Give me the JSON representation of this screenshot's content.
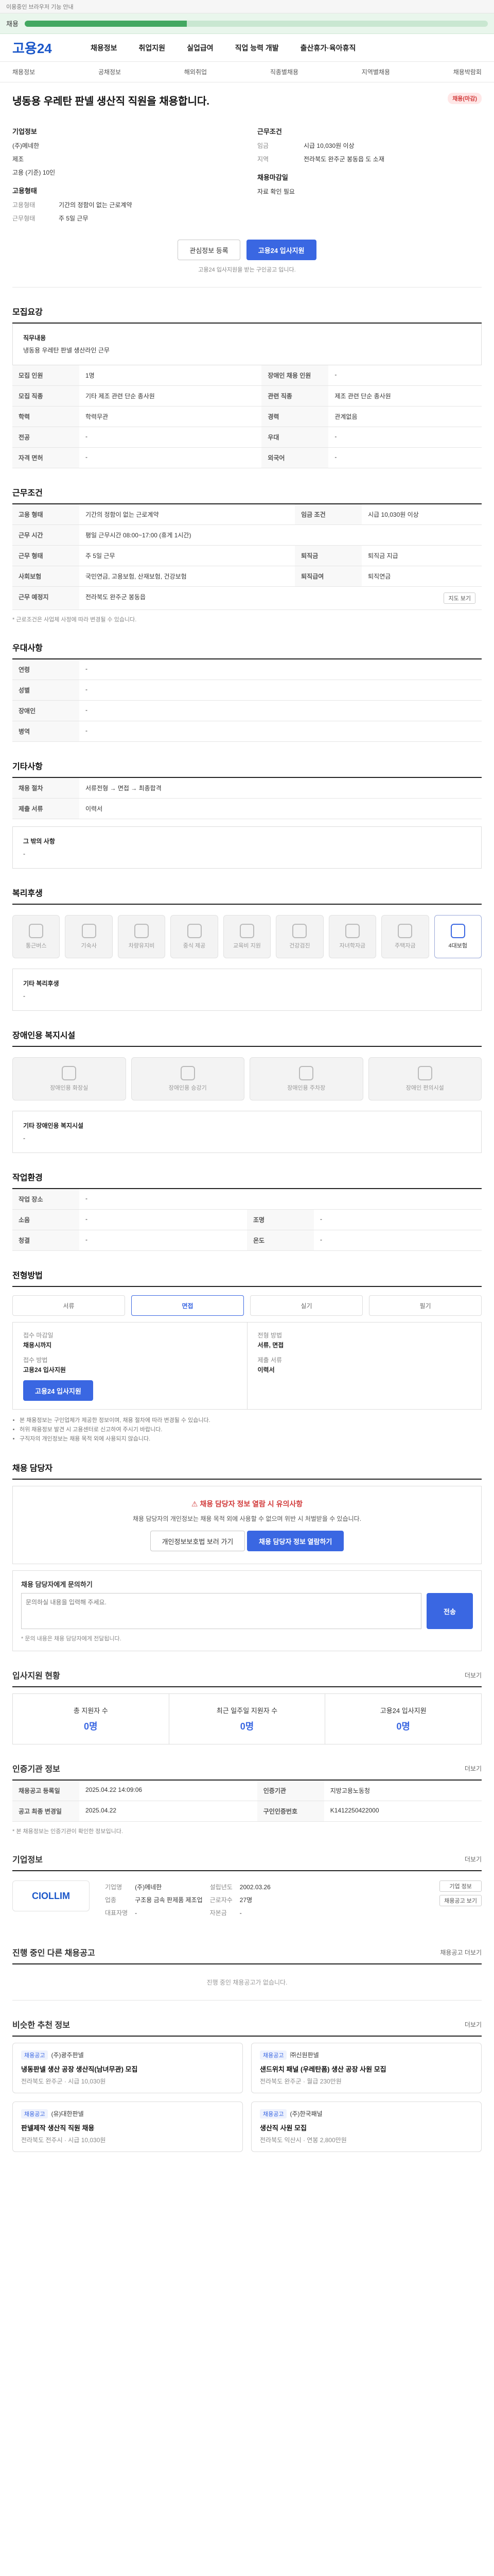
{
  "top": {
    "notice": "이용중인 브라우저 기능 안내",
    "banner_label": "채용"
  },
  "gnb": {
    "logo": "고용24",
    "items": [
      "채용정보",
      "취업지원",
      "실업급여",
      "직업 능력 개발",
      "출산휴가·육아휴직"
    ]
  },
  "subnav": {
    "items": [
      "채용정보",
      "공채정보",
      "해외취업",
      "직종별채용",
      "지역별채용",
      "채용박람회"
    ]
  },
  "job": {
    "title": "냉동용 우레탄 판넬 생산직 직원을 채용합니다.",
    "status_badge": "채용(마감)",
    "company_head": "기업정보",
    "company_name": "(주)메네한",
    "company_meta": [
      "제조",
      "고용 (기준) 10인"
    ],
    "work_head": "근무조건",
    "work_rows": [
      {
        "k": "임금",
        "v": "시급 10,030원 이상"
      },
      {
        "k": "지역",
        "v": "전라북도 완주군 봉동읍 도 소재"
      }
    ],
    "hire_head": "고용형태",
    "hire_rows": [
      {
        "k": "고용형태",
        "v": "기간의 정함이 없는 근로계약"
      },
      {
        "k": "근무형태",
        "v": "주 5일 근무"
      }
    ],
    "deadline_head": "채용마감일",
    "deadline": "자료 확인 필요",
    "save_button": "관심정보 등록",
    "apply_button": "고용24 입사지원",
    "apply_note": "고용24 입사지원을 받는 구인공고 입니다."
  },
  "recruit": {
    "title": "모집요강",
    "duty_title": "직무내용",
    "duty_text": "냉동용 우레탄 판넬 생산라인 근무",
    "rows": [
      {
        "k": "모집 인원",
        "v": "1명",
        "k2": "장애인 채용 인원",
        "v2": "-"
      },
      {
        "k": "모집 직종",
        "v": "기타 제조 관련 단순 종사원",
        "k2": "관련 직종",
        "v2": "제조 관련 단순 종사원"
      },
      {
        "k": "학력",
        "v": "학력무관",
        "k2": "경력",
        "v2": "관계없음"
      },
      {
        "k": "전공",
        "v": "-",
        "k2": "우대",
        "v2": "-"
      },
      {
        "k": "자격 면허",
        "v": "-",
        "k2": "외국어",
        "v2": "-"
      }
    ]
  },
  "conditions": {
    "title": "근무조건",
    "rows": [
      {
        "k": "고용 형태",
        "v": "기간의 정함이 없는 근로계약",
        "k2": "임금 조건",
        "v2": "시급 10,030원 이상"
      },
      {
        "k": "근무 시간",
        "v": "평일 근무시간 08:00~17:00 (휴게 1시간)",
        "k2": "",
        "v2": ""
      },
      {
        "k": "근무 형태",
        "v": "주 5일 근무",
        "k2": "퇴직금",
        "v2": "퇴직금 지급"
      },
      {
        "k": "사회보험",
        "v": "국민연금, 고용보험, 산재보험, 건강보험",
        "k2": "퇴직급여",
        "v2": "퇴직연금"
      },
      {
        "k": "근무 예정지",
        "v": "전라북도 완주군 봉동읍",
        "k2": "",
        "v2": ""
      }
    ],
    "map_button": "지도 보기",
    "foot": "* 근로조건은 사업체 사정에 따라 변경될 수 있습니다."
  },
  "preference": {
    "title": "우대사항",
    "rows": [
      {
        "k": "연령",
        "v": "-"
      },
      {
        "k": "성별",
        "v": "-"
      },
      {
        "k": "장애인",
        "v": "-"
      },
      {
        "k": "병역",
        "v": "-"
      }
    ]
  },
  "other": {
    "title": "기타사항",
    "rows": [
      {
        "k": "채용 절차",
        "v": "서류전형 → 면접 → 최종합격"
      },
      {
        "k": "제출 서류",
        "v": "이력서"
      }
    ],
    "sub_title": "그 밖의 사항",
    "sub_text": "-"
  },
  "welfare": {
    "title": "복리후생",
    "icons": [
      {
        "name": "통근버스",
        "on": false
      },
      {
        "name": "기숙사",
        "on": false
      },
      {
        "name": "차량유지비",
        "on": false
      },
      {
        "name": "중식 제공",
        "on": false
      },
      {
        "name": "교육비 지원",
        "on": false
      },
      {
        "name": "건강검진",
        "on": false
      },
      {
        "name": "자녀학자금",
        "on": false
      },
      {
        "name": "주택자금",
        "on": false
      },
      {
        "name": "4대보험",
        "on": true
      }
    ],
    "extra_title": "기타 복리후생",
    "extra_text": "-"
  },
  "disabled": {
    "title": "장애인용 복지시설",
    "icons": [
      {
        "name": "장애인용 화장실",
        "on": false
      },
      {
        "name": "장애인용 승강기",
        "on": false
      },
      {
        "name": "장애인용 주차장",
        "on": false
      },
      {
        "name": "장애인 편의시설",
        "on": false
      }
    ],
    "extra_title": "기타 장애인용 복지시설",
    "extra_text": "-"
  },
  "environment": {
    "title": "작업환경",
    "rows": [
      {
        "k": "작업 장소",
        "v": "-"
      },
      {
        "k": "소음",
        "v": "-",
        "k2": "조명",
        "v2": "-"
      },
      {
        "k": "청결",
        "v": "-",
        "k2": "온도",
        "v2": "-"
      }
    ]
  },
  "process": {
    "title": "전형방법",
    "steps": [
      "서류",
      "면접",
      "실기",
      "필기"
    ],
    "active": 1
  },
  "apply": {
    "left": [
      {
        "k": "접수 마감일",
        "v": "채용시까지"
      },
      {
        "k": "접수 방법",
        "v": "고용24 입사지원"
      }
    ],
    "right": [
      {
        "k": "전형 방법",
        "v": "서류, 면접"
      },
      {
        "k": "제출 서류",
        "v": "이력서"
      }
    ],
    "button": "고용24 입사지원",
    "notices": [
      "본 채용정보는 구인업체가 제공한 정보이며, 채용 절차에 따라 변경될 수 있습니다.",
      "허위 채용정보 발견 시 고용센터로 신고하여 주시기 바랍니다.",
      "구직자의 개인정보는 채용 목적 외에 사용되지 않습니다."
    ]
  },
  "contact": {
    "title": "채용 담당자",
    "warn": "채용 담당자 정보 열람 시 유의사항",
    "desc": "채용 담당자의 개인정보는 채용 목적 외에 사용할 수 없으며 위반 시 처벌받을 수 있습니다.",
    "button1": "개인정보보호법 보러 가기",
    "button2": "채용 담당자 정보 열람하기",
    "inquiry_title": "채용 담당자에게 문의하기",
    "inquiry_placeholder": "문의하실 내용을 입력해 주세요.",
    "send": "전송",
    "inquiry_notice": "* 문의 내용은 채용 담당자에게 전달됩니다."
  },
  "stats": {
    "title": "입사지원 현황",
    "more": "더보기",
    "items": [
      {
        "k": "총 지원자 수",
        "v": "0명"
      },
      {
        "k": "최근 일주일 지원자 수",
        "v": "0명"
      },
      {
        "k": "고용24 입사지원",
        "v": "0명"
      }
    ]
  },
  "certified": {
    "title": "인증기관 정보",
    "more": "더보기",
    "rows": [
      {
        "k": "채용공고 등록일",
        "v": "2025.04.22 14:09:06",
        "k2": "인증기관",
        "v2": "지방고용노동청"
      },
      {
        "k": "공고 최종 변경일",
        "v": "2025.04.22",
        "k2": "구인인증번호",
        "v2": "K1412250422000"
      }
    ],
    "foot": "* 본 채용정보는 인증기관이 확인한 정보입니다."
  },
  "company": {
    "title": "기업정보",
    "more": "더보기",
    "logo": "CIOLLIM",
    "rows": [
      {
        "k": "기업명",
        "v": "(주)메네한",
        "k2": "설립년도",
        "v2": "2002.03.26"
      },
      {
        "k": "업종",
        "v": "구조용 금속 판제품 제조업",
        "k2": "근로자수",
        "v2": "27명"
      },
      {
        "k": "대표자명",
        "v": "-",
        "k2": "자본금",
        "v2": "-"
      }
    ],
    "button1": "기업 정보",
    "button2": "채용공고 보기"
  },
  "ongoing": {
    "title": "진행 중인 다른 채용공고",
    "more": "채용공고 더보기",
    "empty": "진행 중인 채용공고가 없습니다."
  },
  "similar": {
    "title": "비슷한 추천 정보",
    "more": "더보기",
    "cards": [
      {
        "tag": "채용공고",
        "company": "(주)광주판넬",
        "title": "냉동판넬 생산 공장 생산직(남녀무관) 모집",
        "meta": "전라북도 완주군 · 시급 10,030원"
      },
      {
        "tag": "채용공고",
        "company": "㈜신원판넬",
        "title": "샌드위치 패널 (우레탄폼) 생산 공장 사원 모집",
        "meta": "전라북도 완주군 · 월급 230만원"
      },
      {
        "tag": "채용공고",
        "company": "(유)대한판넬",
        "title": "판넬제작 생산직 직원 채용",
        "meta": "전라북도 전주시 · 시급 10,030원"
      },
      {
        "tag": "채용공고",
        "company": "(주)한국패널",
        "title": "생산직 사원 모집",
        "meta": "전라북도 익산시 · 연봉 2,800만원"
      }
    ]
  }
}
